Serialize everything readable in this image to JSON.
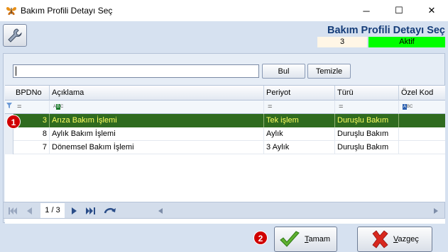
{
  "window": {
    "title": "Bakım Profili Detayı Seç",
    "minimize_glyph": "─",
    "maximize_glyph": "☐",
    "close_glyph": "✕"
  },
  "header": {
    "title": "Bakım Profili Detayı Seç",
    "count": "3",
    "status": "Aktif",
    "status_color": "#00ff00"
  },
  "search": {
    "value": "",
    "search_button": "Bul",
    "clear_button": "Temizle"
  },
  "grid": {
    "columns": [
      "BPDNo",
      "Açıklama",
      "Periyot",
      "Türü",
      "Özel Kod"
    ],
    "filter_ops": [
      "=",
      "ABC",
      "=",
      "=",
      "ABC"
    ],
    "rows": [
      {
        "no": "3",
        "aciklama": "Arıza Bakım İşlemi",
        "periyot": "Tek işlem",
        "turu": "Duruşlu Bakım",
        "ozel": ""
      },
      {
        "no": "8",
        "aciklama": "Aylık Bakım İşlemi",
        "periyot": "Aylık",
        "turu": "Duruşlu Bakım",
        "ozel": ""
      },
      {
        "no": "7",
        "aciklama": "Dönemsel Bakım İşlemi",
        "periyot": "3 Aylık",
        "turu": "Duruşlu Bakım",
        "ozel": ""
      }
    ],
    "selected_row": 0,
    "selected_color": "#2f6b1f"
  },
  "navigator": {
    "page": "1 / 3"
  },
  "footer": {
    "ok_label_first": "T",
    "ok_label_rest": "amam",
    "cancel_label_first": "V",
    "cancel_label_rest": "azgeç"
  },
  "badges": [
    "1",
    "2"
  ]
}
